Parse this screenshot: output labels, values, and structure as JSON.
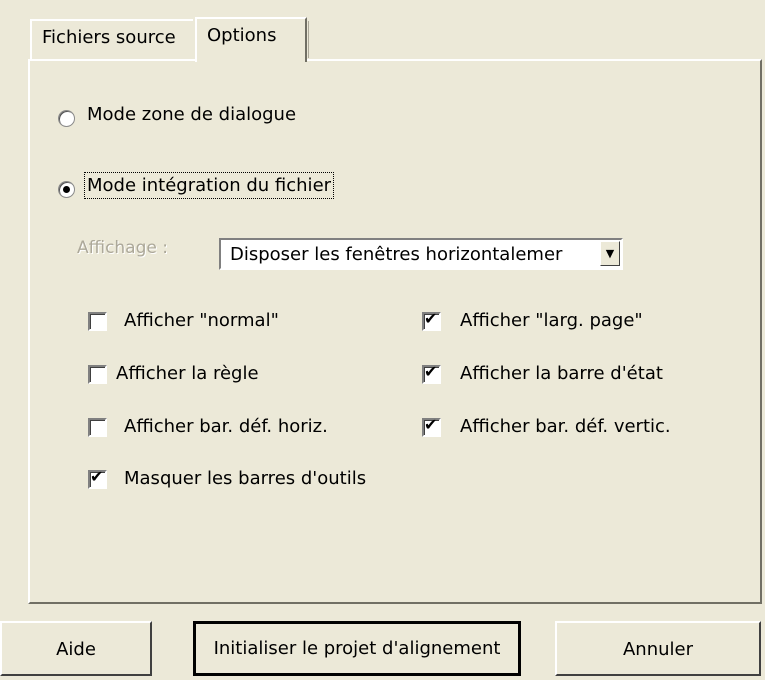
{
  "tabs": [
    {
      "label": "Fichiers source"
    },
    {
      "label": "Options"
    }
  ],
  "options": {
    "mode_dialog_label": "Mode zone de dialogue",
    "mode_dialog_selected": false,
    "mode_integration_label": "Mode intégration du fichier",
    "mode_integration_selected": true,
    "display_label": "Affichage :",
    "display_value": "Disposer les fenêtres horizontalemer",
    "checkboxes": [
      {
        "label": "Afficher \"normal\"",
        "checked": false
      },
      {
        "label": "Afficher \"larg. page\"",
        "checked": true
      },
      {
        "label": "Afficher la règle",
        "checked": false
      },
      {
        "label": "Afficher la barre d'état",
        "checked": true
      },
      {
        "label": "Afficher bar. déf. horiz.",
        "checked": false
      },
      {
        "label": "Afficher bar. déf. vertic.",
        "checked": true
      },
      {
        "label": "Masquer les barres d'outils",
        "checked": true
      }
    ]
  },
  "buttons": {
    "help": "Aide",
    "init": "Initialiser le projet d'alignement",
    "cancel": "Annuler"
  },
  "icons": {
    "dropdown": "chevron-down-icon",
    "check": "checkmark-icon"
  }
}
